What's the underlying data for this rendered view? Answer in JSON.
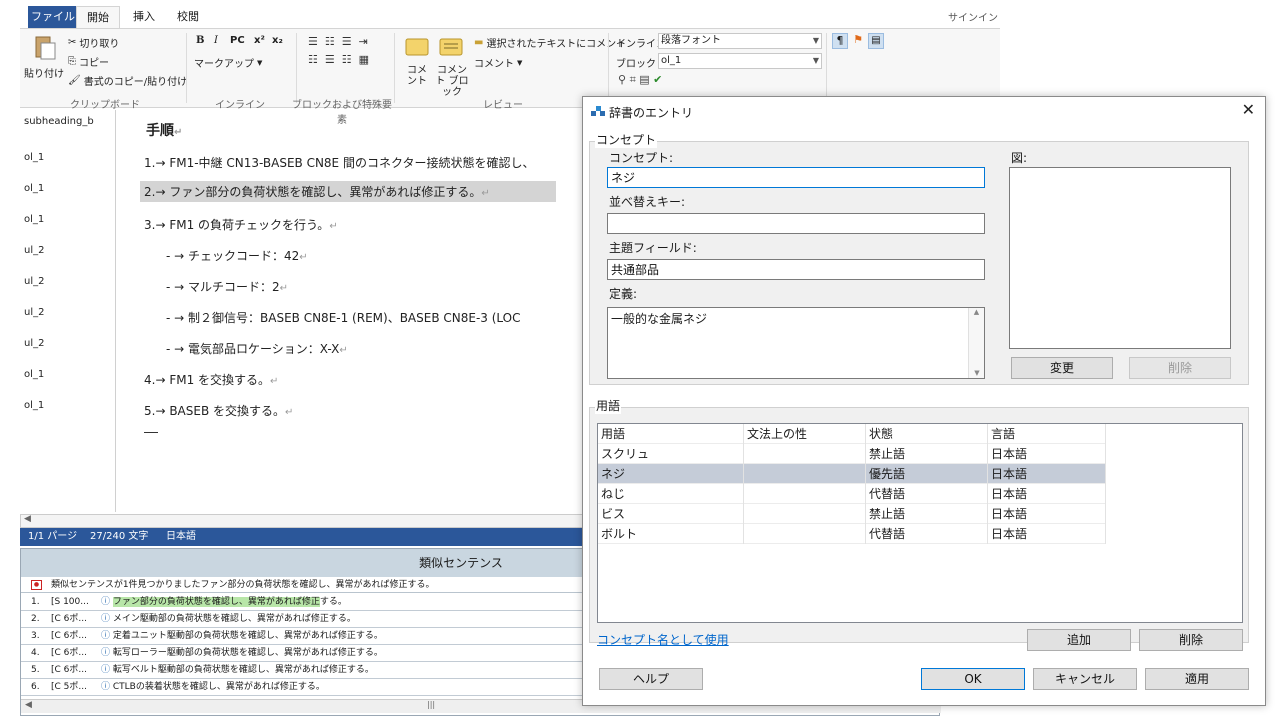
{
  "app": {
    "tabs": [
      {
        "label": "ファイル"
      },
      {
        "label": "開始"
      },
      {
        "label": "挿入"
      },
      {
        "label": "校閲"
      }
    ],
    "signin": "サインイン",
    "ribbon": {
      "paste": "貼り付け",
      "cut": "切り取り",
      "copy": "コピー",
      "format_painter": "書式のコピー/貼り付け",
      "clipboard_group": "クリップボード",
      "bold": "B",
      "italic": "I",
      "pc": "PC",
      "superscript": "x²",
      "subscript": "x₂",
      "markup": "マークアップ",
      "inline_group": "インライン",
      "block_group": "ブロックおよび特殊要素",
      "comment": "コメ ント",
      "comment_block": "コメント ブロック",
      "comment_on_selection": "選択されたテキストにコメント",
      "comment_menu": "コメント",
      "review_group": "レビュー",
      "inline_label": "インライン",
      "inline_value": "段落フォント",
      "block_label": "ブロック",
      "block_value": "ol_1"
    },
    "style_labels": [
      "subheading_b",
      "ol_1",
      "ol_1",
      "ol_1",
      "ul_2",
      "ul_2",
      "ul_2",
      "ul_2",
      "ol_1",
      "ol_1"
    ],
    "doc_lines": [
      {
        "text": "手順"
      },
      {
        "text": "1.→ FM1-中継 CN13-BASEB CN8E 間のコネクター接続状態を確認し、"
      },
      {
        "text": "2.→ ファン部分の負荷状態を確認し、異常があれば修正する。"
      },
      {
        "text": "3.→ FM1 の負荷チェックを行う。"
      },
      {
        "text": "- →  チェックコード：42"
      },
      {
        "text": "- →  マルチコード：2"
      },
      {
        "text": "- →  制２御信号：BASEB CN8E-1 (REM)、BASEB CN8E-3 (LOC"
      },
      {
        "text": "- →  電気部品ロケーション：X-X"
      },
      {
        "text": "4.→ FM1 を交換する。"
      },
      {
        "text": "5.→ BASEB を交換する。"
      }
    ],
    "status": {
      "page": "1/1 パージ",
      "chars": "27/240 文字",
      "lang": "日本語"
    },
    "similar": {
      "title": "類似センテンス",
      "header": "類似センテンスが1件見つかりましたファン部分の負荷状態を確認し、異常があれば修正する。",
      "rows": [
        {
          "num": "1.",
          "src": "[S 100...",
          "pre": "",
          "hi": "ファン部分の負荷状態を確認し、異常があれば修正",
          "post": "する。"
        },
        {
          "num": "2.",
          "src": "[C 6ポ...",
          "pre": "",
          "hi": "",
          "post": "メイン駆動部の負荷状態を確認し、異常があれば修正する。"
        },
        {
          "num": "3.",
          "src": "[C 6ポ...",
          "pre": "",
          "hi": "",
          "post": "定着ユニット駆動部の負荷状態を確認し、異常があれば修正する。"
        },
        {
          "num": "4.",
          "src": "[C 6ポ...",
          "pre": "",
          "hi": "",
          "post": "転写ローラー駆動部の負荷状態を確認し、異常があれば修正する。"
        },
        {
          "num": "5.",
          "src": "[C 6ポ...",
          "pre": "",
          "hi": "",
          "post": "転写ベルト駆動部の負荷状態を確認し、異常があれば修正する。"
        },
        {
          "num": "6.",
          "src": "[C 5ポ...",
          "pre": "",
          "hi": "",
          "post": "CTLBの装着状態を確認し、異常があれば修正する。"
        }
      ]
    }
  },
  "dialog": {
    "title": "辞書のエントリ",
    "concept_group": "コンセプト",
    "concept_label": "コンセプト:",
    "concept_value": "ネジ",
    "sort_label": "並べ替えキー:",
    "sort_value": "",
    "subject_label": "主題フィールド:",
    "subject_value": "共通部品",
    "definition_label": "定義:",
    "definition_value": "一般的な金属ネジ",
    "figure_label": "図:",
    "change_button": "変更",
    "delete_figure_button": "削除",
    "terms_group": "用語",
    "columns": [
      "用語",
      "文法上の性",
      "状態",
      "言語"
    ],
    "terms": [
      {
        "term": "スクリュ",
        "gender": "",
        "status": "禁止語",
        "lang": "日本語"
      },
      {
        "term": "ネジ",
        "gender": "",
        "status": "優先語",
        "lang": "日本語"
      },
      {
        "term": "ねじ",
        "gender": "",
        "status": "代替語",
        "lang": "日本語"
      },
      {
        "term": "ビス",
        "gender": "",
        "status": "禁止語",
        "lang": "日本語"
      },
      {
        "term": "ボルト",
        "gender": "",
        "status": "代替語",
        "lang": "日本語"
      }
    ],
    "use_as_concept_link": "コンセプト名として使用",
    "add_button": "追加",
    "delete_button": "削除",
    "help_button": "ヘルプ",
    "ok_button": "OK",
    "cancel_button": "キャンセル",
    "apply_button": "適用"
  }
}
